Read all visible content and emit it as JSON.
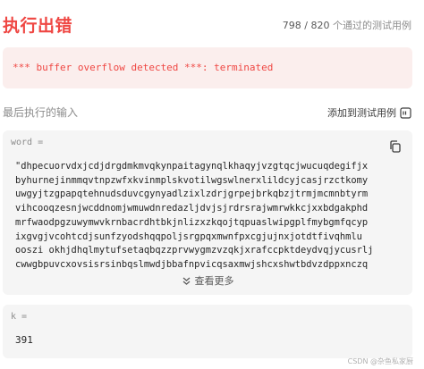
{
  "header": {
    "status": "执行出错",
    "passed": "798",
    "separator": " / ",
    "total": "820",
    "passed_suffix": "个通过的测试用例"
  },
  "error": {
    "message": "*** buffer overflow detected ***: terminated"
  },
  "last_input": {
    "title": "最后执行的输入",
    "add_testcase_label": "添加到测试用例"
  },
  "inputs": {
    "word": {
      "label": "word =",
      "lines": [
        "\"dhpecuorvdxjcdjdrgdmkmvqkynpaitagynqlkhaqyjvzgtqcjwucuqdegifjx",
        "byhurnejinmmqvtnpzwfxkvinmplskvotilwgswlnerxlildcyjcasjrzctkomy",
        "uwgyjtzgpapqtehnudsduvcgynyadlzixlzdrjgrpejbrkqbzjtrmjmcmnbtyrm",
        "vihcooqzesnjwcddnomjwmuwdnredazljdvjsjrdrsrajwmrwkkcjxxbdgakphd",
        "mrfwaodpgzuwymwvkrnbacrdhtbkjnlizxzkqojtqpuaslwipgplfmybgmfqcyp",
        "ixgvgjvcohtcdjsunfzyodshqqpoljsrgpqxmwnfpxcgjujnxjotdtfivqhmlu",
        "ooszi okhjdhqlmytufsetaqbqzzprvwygmzvzqkjxrafccpktdeydvqjycusrlj",
        "cwwgbpuvcxovsisrsinbqslmwdjbbafnpvicqsaxmwjshcxshwtbdvzdppxnczq"
      ],
      "show_more": "查看更多"
    },
    "k": {
      "label": "k =",
      "value": "391"
    }
  },
  "watermark": "CSDN @杂鱼私家厨"
}
